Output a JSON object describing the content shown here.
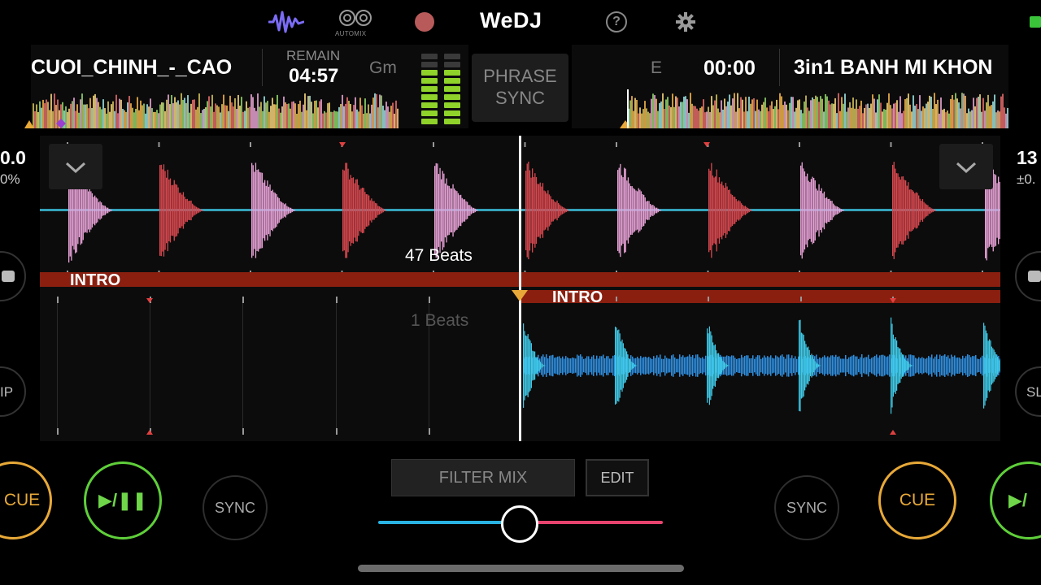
{
  "app": {
    "title": "WeDJ",
    "automix_label": "AUTOMIX",
    "help_label": "?"
  },
  "deck_a": {
    "title": "CUOI_CHINH_-_CAO",
    "remain_label": "REMAIN",
    "remain_time": "04:57",
    "key": "Gm",
    "beats_label": "47 Beats",
    "phrase_label": "INTRO",
    "pitch_value": "0.0",
    "pitch_range": "0%",
    "cue_label": "CUE",
    "play_label": "▶/❚❚",
    "sync_label": "SYNC",
    "side_label": "IP"
  },
  "deck_b": {
    "title": "3in1 BANH MI KHON",
    "time": "00:00",
    "key": "E",
    "beats_label": "1 Beats",
    "phrase_label": "INTRO",
    "pitch_value": "13",
    "pitch_range": "±0.",
    "cue_label": "CUE",
    "play_label": "▶/",
    "sync_label": "SYNC",
    "side_label": "SL"
  },
  "center": {
    "phrase_sync_line1": "PHRASE",
    "phrase_sync_line2": "SYNC",
    "filter_mix_label": "FILTER MIX",
    "edit_label": "EDIT",
    "crossfader_level": 0.5
  },
  "colors": {
    "accent_purple": "#7b6cf6",
    "cue_orange": "#e8a938",
    "play_green": "#5fcf3a",
    "deck_a_wave_red": "#d9484f",
    "deck_a_wave_pink": "#e9a2d8",
    "deck_b_wave_cyan": "#3fc9e6",
    "phrase_bar": "#8a1f10",
    "crossfader_left": "#29b3e3",
    "crossfader_right": "#e8436e",
    "meter_on": "#8fd22a"
  },
  "icons": [
    "waveform-icon",
    "automix-icon",
    "record-icon",
    "help-icon",
    "settings-gear-icon",
    "chevron-down-icon",
    "battery-icon"
  ]
}
